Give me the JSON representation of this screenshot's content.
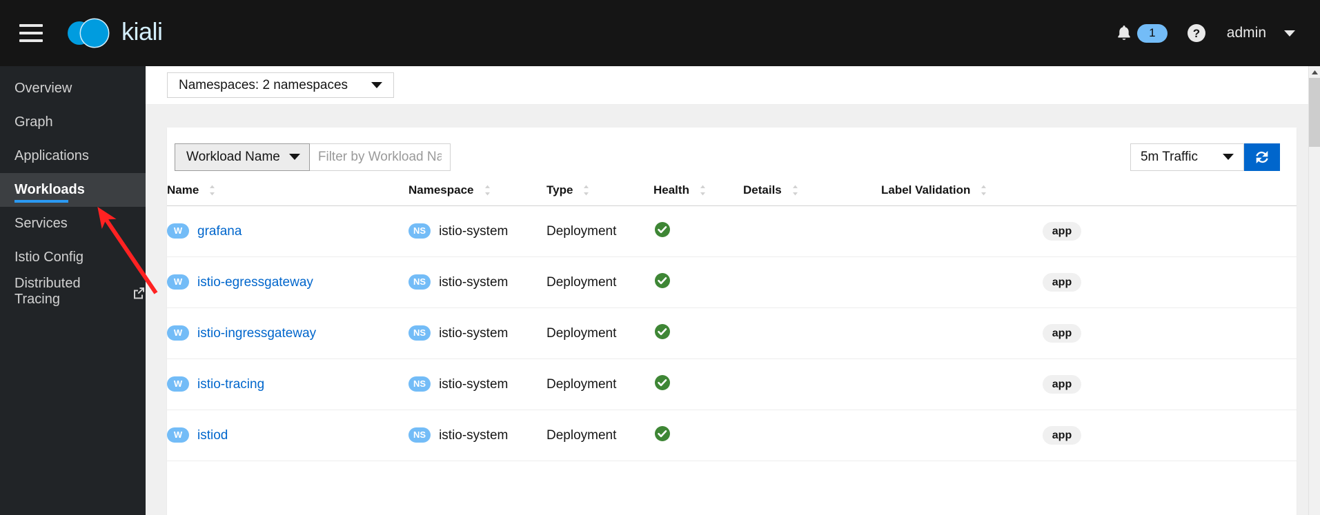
{
  "masthead": {
    "brand_name": "kiali",
    "menu_icon": "hamburger-icon",
    "notification_count": "1",
    "user_name": "admin",
    "accent_color": "#73bcf7"
  },
  "sidebar": {
    "items": [
      {
        "label": "Overview",
        "active": false,
        "external": false
      },
      {
        "label": "Graph",
        "active": false,
        "external": false
      },
      {
        "label": "Applications",
        "active": false,
        "external": false
      },
      {
        "label": "Workloads",
        "active": true,
        "external": false
      },
      {
        "label": "Services",
        "active": false,
        "external": false
      },
      {
        "label": "Istio Config",
        "active": false,
        "external": false
      },
      {
        "label": "Distributed Tracing",
        "active": false,
        "external": true
      }
    ],
    "active_accent": "#2b9af3"
  },
  "namespace_bar": {
    "selector_label": "Namespaces: 2 namespaces"
  },
  "toolbar": {
    "filter_type_label": "Workload Name",
    "filter_placeholder": "Filter by Workload Name",
    "filter_value": "",
    "traffic_label": "5m Traffic",
    "refresh_label": "",
    "refresh_color": "#0066cc"
  },
  "table": {
    "columns": [
      {
        "label": "Name",
        "sortable": true
      },
      {
        "label": "Namespace",
        "sortable": true
      },
      {
        "label": "Type",
        "sortable": true
      },
      {
        "label": "Health",
        "sortable": true
      },
      {
        "label": "Details",
        "sortable": true
      },
      {
        "label": "Label Validation",
        "sortable": true
      }
    ],
    "rows": [
      {
        "badge": "W",
        "name": "grafana",
        "ns_badge": "NS",
        "namespace": "istio-system",
        "type": "Deployment",
        "health": "healthy",
        "details": "",
        "label_validation": "app"
      },
      {
        "badge": "W",
        "name": "istio-egressgateway",
        "ns_badge": "NS",
        "namespace": "istio-system",
        "type": "Deployment",
        "health": "healthy",
        "details": "",
        "label_validation": "app"
      },
      {
        "badge": "W",
        "name": "istio-ingressgateway",
        "ns_badge": "NS",
        "namespace": "istio-system",
        "type": "Deployment",
        "health": "healthy",
        "details": "",
        "label_validation": "app"
      },
      {
        "badge": "W",
        "name": "istio-tracing",
        "ns_badge": "NS",
        "namespace": "istio-system",
        "type": "Deployment",
        "health": "healthy",
        "details": "",
        "label_validation": "app"
      },
      {
        "badge": "W",
        "name": "istiod",
        "ns_badge": "NS",
        "namespace": "istio-system",
        "type": "Deployment",
        "health": "healthy",
        "details": "",
        "label_validation": "app"
      }
    ],
    "health_ok_color": "#3e8635",
    "link_color": "#0066cc"
  },
  "annotation": {
    "arrow_color": "#f22",
    "points_to": "Workloads"
  }
}
